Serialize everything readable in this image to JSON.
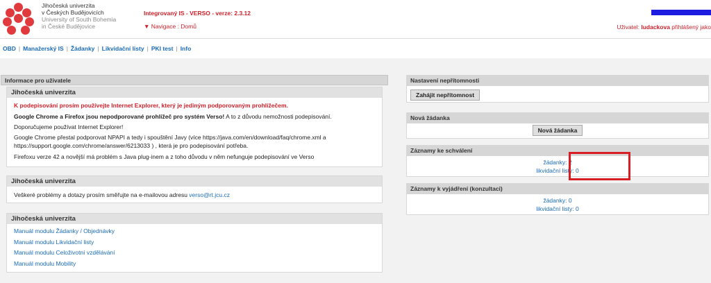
{
  "header": {
    "university_lines": [
      "Jihočeská univerzita",
      "v Českých Budějovicích",
      "University of South Bohemia",
      "in České Budějovice"
    ],
    "app_title": "Integrovaný IS - VERSO - verze: 2.3.12",
    "navigation_text": "▼ Navigace : Domů",
    "user_label": "Uživatel:",
    "user_name": "ludackova",
    "user_status": "přihlášený jako"
  },
  "menu": {
    "items": [
      "OBD",
      "Manažerský IS",
      "Žádanky",
      "Likvidační listy",
      "PKI test",
      "Info"
    ]
  },
  "left_panel": {
    "title": "Informace pro uživatele",
    "box1": {
      "heading": "Jihočeská univerzita",
      "warning": "K podepisování prosím používejte Internet Explorer, který je jediným podporovaným prohlížečem.",
      "chrome_bold": "Google Chrome a Firefox jsou nepodporované prohlížeč pro systém Verso!",
      "chrome_rest": " A to z důvodu nemožnosti podepisování.",
      "recommend": "Doporučujeme používat Internet Explorer!",
      "npapi_1": "Google Chrome přestal podporovat NPAPI a tedy i spouštění Javy (více https://java.com/en/download/faq/chrome.xml a",
      "npapi_2": "https://support.google.com/chrome/answer/6213033 ) , která je pro podepisování potřeba.",
      "firefox": "Firefoxu verze 42 a novější má problém s Java plug-inem a z toho důvodu v něm nefunguje podepisování ve Verso"
    },
    "box2": {
      "heading": "Jihočeská univerzita",
      "text": "Veškeré problémy a dotazy prosím směřujte na e-mailovou adresu ",
      "email": "verso@rt.jcu.cz"
    },
    "box3": {
      "heading": "Jihočeská univerzita",
      "links": [
        "Manuál modulu Žádanky / Objednávky",
        "Manuál modulu Likvidační listy",
        "Manuál modulu Celoživotní vzdělávání",
        "Manuál modulu Mobility"
      ]
    }
  },
  "right_panel": {
    "absence": {
      "title": "Nastavení nepřítomnosti",
      "button": "Zahájit nepřítomnost"
    },
    "new_request": {
      "title": "Nová žádanka",
      "button": "Nová žádanka"
    },
    "approval": {
      "title": "Záznamy ke schválení",
      "requests": "žádanky: 2",
      "liquidation": "likvidační listy: 0"
    },
    "consult": {
      "title": "Záznamy k vyjádření (konzultaci)",
      "requests": "žádanky: 0",
      "liquidation": "likvidační listy: 0"
    }
  }
}
